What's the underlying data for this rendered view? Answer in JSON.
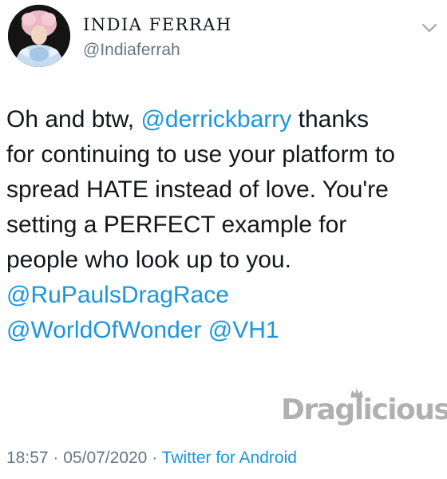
{
  "author": {
    "display_name": "INDIA FERRAH",
    "handle": "@Indiaferrah",
    "avatar_icon": "profile-photo"
  },
  "tweet": {
    "lines": [
      [
        {
          "text": "Oh and btw, "
        },
        {
          "text": "@derrickbarry",
          "mention": true
        },
        {
          "text": " thanks"
        }
      ],
      [
        {
          "text": "for continuing to use your platform to"
        }
      ],
      [
        {
          "text": "spread HATE instead of love. You're"
        }
      ],
      [
        {
          "text": "setting a PERFECT example for"
        }
      ],
      [
        {
          "text": "people who look up to you."
        }
      ],
      [
        {
          "text": "@RuPaulsDragRace",
          "mention": true
        }
      ],
      [
        {
          "text": "@WorldOfWonder",
          "mention": true
        },
        {
          "text": " "
        },
        {
          "text": "@VH1",
          "mention": true
        }
      ]
    ]
  },
  "watermark": {
    "text": "Draglicious"
  },
  "meta": {
    "time": "18:57",
    "separator": "·",
    "date": "05/07/2020",
    "source": "Twitter for Android"
  },
  "colors": {
    "link": "#1b95e0",
    "secondary_text": "#657786",
    "primary_text": "#14171a"
  }
}
